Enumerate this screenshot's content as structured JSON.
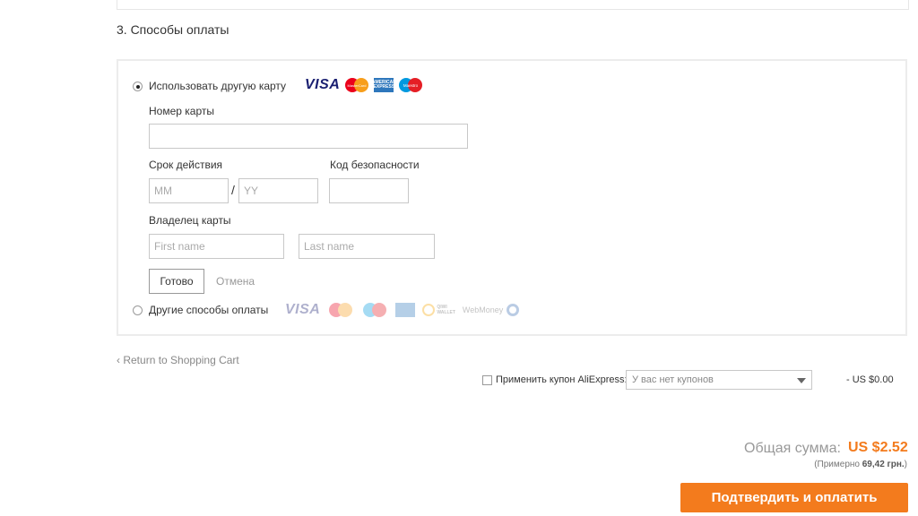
{
  "section": {
    "title": "3. Способы оплаты"
  },
  "card_option": {
    "label": "Использовать другую карту",
    "selected": true,
    "logos": {
      "visa": "VISA",
      "mastercard": "MasterCard",
      "amex_line1": "AMERICAN",
      "amex_line2": "EXPRESS",
      "maestro": "Maestro"
    }
  },
  "form": {
    "card_number_label": "Номер карты",
    "card_number_value": "",
    "expiry_label": "Срок действия",
    "month_placeholder": "MM",
    "year_placeholder": "YY",
    "separator": "/",
    "cvv_label": "Код безопасности",
    "owner_label": "Владелец карты",
    "first_name_placeholder": "First name",
    "last_name_placeholder": "Last name",
    "done_button": "Готово",
    "cancel_link": "Отмена"
  },
  "other_option": {
    "label": "Другие способы оплаты",
    "selected": false,
    "logos": {
      "visa": "VISA",
      "qiwi_line1": "QIWI",
      "qiwi_line2": "WALLET",
      "webmoney": "WebMoney"
    }
  },
  "footer": {
    "return_link": "Return to Shopping Cart",
    "coupon_label": "Применить купон AliExpress:",
    "coupon_select_value": "У вас нет купонов",
    "discount": "- US $0.00",
    "total_label": "Общая сумма:",
    "total_value": "US $2.52",
    "approx_prefix": "(Примерно",
    "approx_value": "69,42 грн.",
    "approx_suffix": ")",
    "confirm_button": "Подтвердить и оплатить"
  },
  "colors": {
    "accent": "#f37b1d",
    "visa_blue": "#1a1f71",
    "amex_blue": "#2e77bc"
  },
  "icons": {
    "back": "chevron-left-icon",
    "dropdown": "caret-down-icon"
  }
}
